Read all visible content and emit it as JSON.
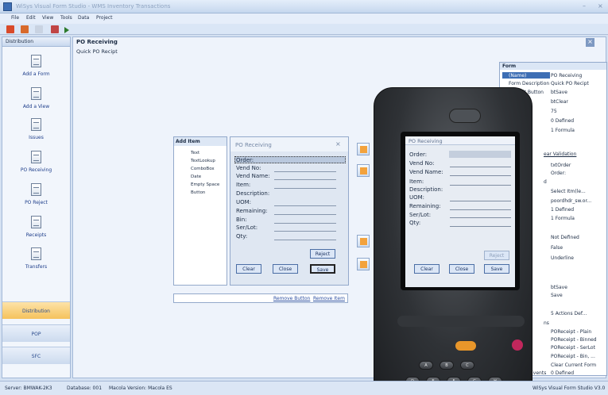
{
  "app": {
    "title": "WiSys Visual Form Studio - WMS Inventory Transactions"
  },
  "menu": [
    "File",
    "Edit",
    "View",
    "Tools",
    "Data",
    "Project"
  ],
  "nav": {
    "header": "Distribution",
    "items": [
      "Add a Form",
      "Add a View",
      "Issues",
      "PO Receiving",
      "PO Reject",
      "Receipts",
      "Transfers"
    ],
    "sections": [
      "Distribution",
      "POP",
      "SFC"
    ]
  },
  "document": {
    "title": "PO Receiving",
    "subtitle": "Quick PO Recipt"
  },
  "add_item": {
    "title": "Add Item",
    "items": [
      "Text",
      "TextLookup",
      "ComboBox",
      "Date",
      "Empty Space",
      "Button"
    ]
  },
  "form_preview": {
    "title": "PO Receiving",
    "fields": [
      "Order:",
      "Vend No:",
      "Vend Name:",
      "Item:",
      "Description:",
      "UOM:",
      "Remaining:",
      "Bin:",
      "Ser/Lot:",
      "Qty:"
    ],
    "buttons": {
      "reject": "Reject",
      "clear": "Clear",
      "close": "Close",
      "save": "Save"
    }
  },
  "links": {
    "remove_button": "Remove Button",
    "remove_item": "Remove Item"
  },
  "device_screen": {
    "title": "PO Receiving",
    "fields": [
      "Order:",
      "Vend No:",
      "Vend Name:",
      "Item:",
      "Description:",
      "UOM:",
      "Remaining:",
      "Ser/Lot:",
      "Qty:"
    ],
    "buttons": {
      "reject": "Reject",
      "clear": "Clear",
      "close": "Close",
      "save": "Save"
    },
    "keys_row1": [
      "A",
      "B",
      "C"
    ],
    "keys_row2": [
      "D",
      "E",
      "F",
      "G",
      "H"
    ]
  },
  "properties": {
    "header": "Form",
    "rows": [
      {
        "name": "(Name)",
        "value": "PO Receiving"
      },
      {
        "name": "Form Description",
        "value": "Quick PO Recipt"
      },
      {
        "name": "Default Button",
        "value": "btSave"
      },
      {
        "name": "",
        "value": "btClear"
      },
      {
        "name": "",
        "value": "75"
      },
      {
        "name": "",
        "value": "0 Defined"
      },
      {
        "name": "",
        "value": "1 Formula"
      }
    ],
    "section2": "ear Validation",
    "rows2": [
      "txtOrder",
      "Order:"
    ],
    "section3": "d",
    "rows3": [
      "Select Itm(le...",
      "poordhdr_sw.or...",
      "1 Defined",
      "1 Formula"
    ],
    "rows4": [
      "Not Defined",
      "False",
      "Underline"
    ],
    "rows5": [
      "btSave",
      "Save"
    ],
    "rows6": [
      "5 Actions Def..."
    ],
    "section7": "ns",
    "rows7": [
      "POReceipt - Plain",
      "POReceipt - Binned",
      "POReceipt - SerLot",
      "POReceipt - Bin, ...",
      "Clear Current Form"
    ],
    "events_label": "Events",
    "events_value": "0 Defined"
  },
  "status": {
    "server": "Server: BMWAK-2K3",
    "database": "Database: 001",
    "version": "Macola Version: Macola ES",
    "product": "WiSys Visual Form Studio V3.0"
  },
  "colors": {
    "accent": "#3d6eb4",
    "nav_selected": "#f7c86a",
    "device": "#2f3236"
  }
}
